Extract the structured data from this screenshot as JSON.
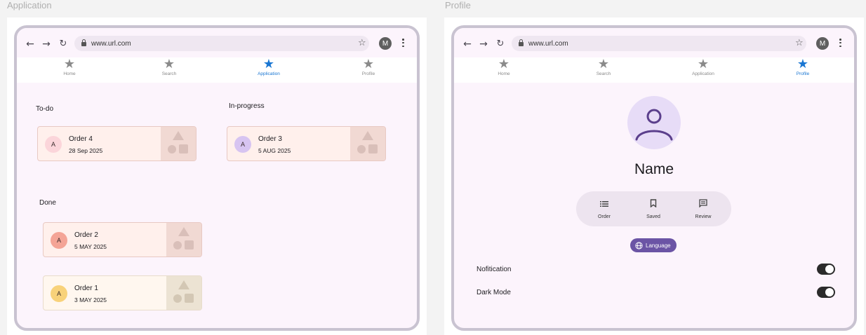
{
  "frames": {
    "application_label": "Application",
    "profile_label": "Profile"
  },
  "browser": {
    "back_icon": "arrow-left-icon",
    "forward_icon": "arrow-right-icon",
    "reload_icon": "reload-icon",
    "url": "www.url.com",
    "bookmark_icon": "star-outline-icon",
    "account_initial": "M",
    "menu_icon": "kebab-menu-icon"
  },
  "tabs": [
    {
      "label": "Home",
      "icon": "star-icon"
    },
    {
      "label": "Search",
      "icon": "star-icon"
    },
    {
      "label": "Application",
      "icon": "star-icon"
    },
    {
      "label": "Profile",
      "icon": "star-icon"
    }
  ],
  "application": {
    "active_tab": "Application",
    "sections": {
      "todo": {
        "title": "To-do",
        "cards": [
          {
            "avatar": "A",
            "title": "Order 4",
            "date": "28 Sep 2025",
            "avatar_color": "#fbd5da"
          }
        ]
      },
      "in_progress": {
        "title": "In-progress",
        "cards": [
          {
            "avatar": "A",
            "title": "Order 3",
            "date": "5 AUG 2025",
            "avatar_color": "#d7c4f1"
          }
        ]
      },
      "done": {
        "title": "Done",
        "cards": [
          {
            "avatar": "A",
            "title": "Order 2",
            "date": "5 MAY 2025",
            "avatar_color": "#f4a496"
          },
          {
            "avatar": "A",
            "title": "Order 1",
            "date": "3 MAY 2025",
            "avatar_color": "#f8d27a"
          }
        ]
      }
    }
  },
  "profile": {
    "active_tab": "Profile",
    "avatar_icon": "person-icon",
    "name": "Name",
    "actions": [
      {
        "label": "Order",
        "icon": "list-icon"
      },
      {
        "label": "Saved",
        "icon": "bookmark-icon"
      },
      {
        "label": "Review",
        "icon": "comment-icon"
      }
    ],
    "language_chip": {
      "label": "Language",
      "icon": "globe-icon"
    },
    "settings": [
      {
        "label": "Nofitication",
        "enabled": true
      },
      {
        "label": "Dark Mode",
        "enabled": true
      }
    ]
  },
  "colors": {
    "accent": "#1976d2",
    "chip": "#6b54a5",
    "device_border": "#c9c3d1",
    "surface": "#fcf4fc",
    "card": "#fff0ec"
  }
}
